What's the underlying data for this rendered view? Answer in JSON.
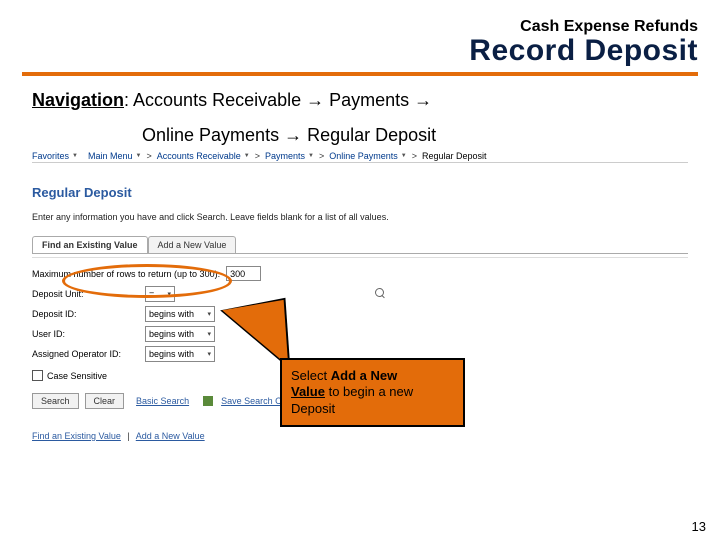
{
  "header": {
    "small": "Cash Expense Refunds",
    "large": "Record Deposit"
  },
  "navigation": {
    "label": "Navigation",
    "line1": ": Accounts Receivable → Payments →",
    "line2": "Online Payments →  Regular Deposit"
  },
  "breadcrumb": {
    "items": [
      "Favorites",
      "Main Menu",
      "Accounts Receivable",
      "Payments",
      "Online Payments",
      "Regular Deposit"
    ]
  },
  "page": {
    "heading": "Regular Deposit",
    "help": "Enter any information you have and click Search. Leave fields blank for a list of all values.",
    "tabs": {
      "find": "Find an Existing Value",
      "add": "Add a New Value"
    },
    "maxrows": {
      "label": "Maximum number of rows to return (up to 300):",
      "value": "300"
    },
    "fields": {
      "depositUnit": {
        "label": "Deposit Unit:",
        "op": "="
      },
      "depositId": {
        "label": "Deposit ID:",
        "op": "begins with"
      },
      "userId": {
        "label": "User ID:",
        "op": "begins with"
      },
      "assigned": {
        "label": "Assigned Operator ID:",
        "op": "begins with"
      }
    },
    "caseSensitive": "Case Sensitive",
    "buttons": {
      "search": "Search",
      "clear": "Clear",
      "basic": "Basic Search",
      "save": "Save Search Criteria"
    },
    "footer": {
      "find": "Find an Existing Value",
      "add": "Add a New Value"
    }
  },
  "callout": {
    "t1": "Select ",
    "b1": "Add a New",
    "b2": "Value",
    "t2": " to begin a new",
    "t3": "Deposit"
  },
  "pageNumber": "13"
}
